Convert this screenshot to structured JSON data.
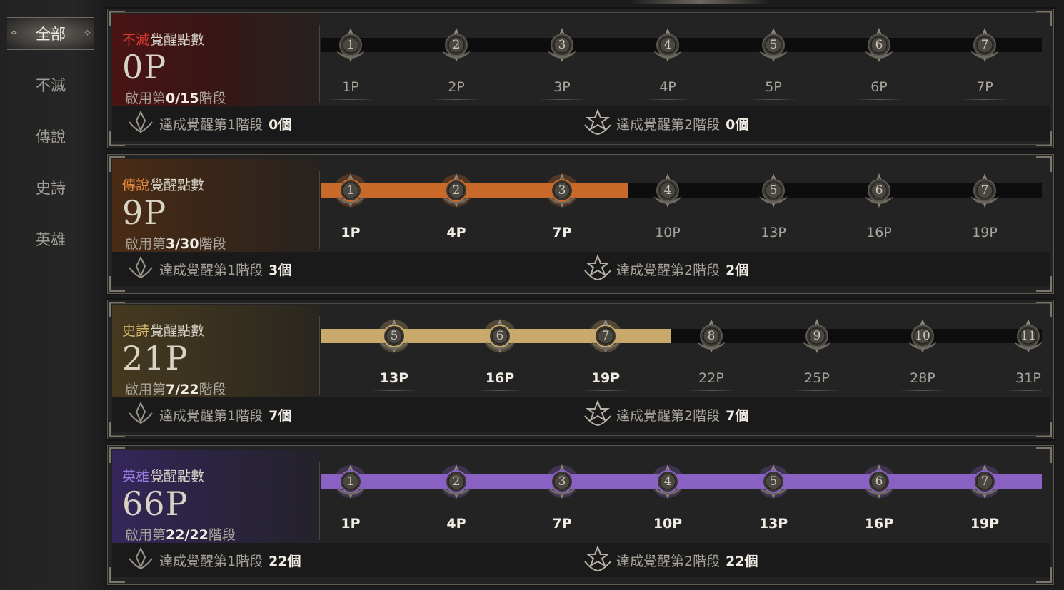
{
  "sidebar": {
    "items": [
      {
        "label": "全部",
        "active": true
      },
      {
        "label": "不滅",
        "active": false
      },
      {
        "label": "傳說",
        "active": false
      },
      {
        "label": "史詩",
        "active": false
      },
      {
        "label": "英雄",
        "active": false
      }
    ]
  },
  "colors": {
    "immortal": "#e0392f",
    "legendary": "#e58b3d",
    "epic": "#d7b56d",
    "hero": "#9b7be0",
    "fill_legendary": "#c96a2a",
    "fill_epic": "#c9aa6b",
    "fill_hero": "#8a62c4"
  },
  "panels": [
    {
      "grade": "不滅",
      "grade_color": "#e0392f",
      "title_suffix": "覺醒點數",
      "points": "0P",
      "stage_prefix": "啟用第",
      "stage_value": "0/15",
      "stage_suffix": "階段",
      "fill_color": "#c96a2a",
      "fill_fraction": 0.0,
      "nodes": [
        {
          "num": "1",
          "label": "1P",
          "on": false
        },
        {
          "num": "2",
          "label": "2P",
          "on": false
        },
        {
          "num": "3",
          "label": "3P",
          "on": false
        },
        {
          "num": "4",
          "label": "4P",
          "on": false
        },
        {
          "num": "5",
          "label": "5P",
          "on": false
        },
        {
          "num": "6",
          "label": "6P",
          "on": false
        },
        {
          "num": "7",
          "label": "7P",
          "on": false
        }
      ],
      "ach1": {
        "text": "達成覺醒第1階段",
        "count": "0個"
      },
      "ach2": {
        "text": "達成覺醒第2階段",
        "count": "0個"
      }
    },
    {
      "grade": "傳說",
      "grade_color": "#e58b3d",
      "title_suffix": "覺醒點數",
      "points": "9P",
      "stage_prefix": "啟用第",
      "stage_value": "3/30",
      "stage_suffix": "階段",
      "fill_color": "#c96a2a",
      "fill_fraction": 0.426,
      "nodes": [
        {
          "num": "1",
          "label": "1P",
          "on": true
        },
        {
          "num": "2",
          "label": "4P",
          "on": true
        },
        {
          "num": "3",
          "label": "7P",
          "on": true
        },
        {
          "num": "4",
          "label": "10P",
          "on": false
        },
        {
          "num": "5",
          "label": "13P",
          "on": false
        },
        {
          "num": "6",
          "label": "16P",
          "on": false
        },
        {
          "num": "7",
          "label": "19P",
          "on": false
        }
      ],
      "ach1": {
        "text": "達成覺醒第1階段",
        "count": "3個"
      },
      "ach2": {
        "text": "達成覺醒第2階段",
        "count": "2個"
      }
    },
    {
      "grade": "史詩",
      "grade_color": "#d7b56d",
      "title_suffix": "覺醒點數",
      "points": "21P",
      "stage_prefix": "啟用第",
      "stage_value": "7/22",
      "stage_suffix": "階段",
      "fill_color": "#c9aa6b",
      "fill_fraction": 0.485,
      "offset": true,
      "nodes": [
        {
          "num": "5",
          "label": "13P",
          "on": true
        },
        {
          "num": "6",
          "label": "16P",
          "on": true
        },
        {
          "num": "7",
          "label": "19P",
          "on": true
        },
        {
          "num": "8",
          "label": "22P",
          "on": false
        },
        {
          "num": "9",
          "label": "25P",
          "on": false
        },
        {
          "num": "10",
          "label": "28P",
          "on": false
        },
        {
          "num": "11",
          "label": "31P",
          "on": false
        }
      ],
      "ach1": {
        "text": "達成覺醒第1階段",
        "count": "7個"
      },
      "ach2": {
        "text": "達成覺醒第2階段",
        "count": "7個"
      }
    },
    {
      "grade": "英雄",
      "grade_color": "#9b7be0",
      "title_suffix": "覺醒點數",
      "points": "66P",
      "stage_prefix": "啟用第",
      "stage_value": "22/22",
      "stage_suffix": "階段",
      "fill_color": "#8a62c4",
      "fill_fraction": 1.0,
      "nodes": [
        {
          "num": "1",
          "label": "1P",
          "on": true
        },
        {
          "num": "2",
          "label": "4P",
          "on": true
        },
        {
          "num": "3",
          "label": "7P",
          "on": true
        },
        {
          "num": "4",
          "label": "10P",
          "on": true
        },
        {
          "num": "5",
          "label": "13P",
          "on": true
        },
        {
          "num": "6",
          "label": "16P",
          "on": true
        },
        {
          "num": "7",
          "label": "19P",
          "on": true
        }
      ],
      "ach1": {
        "text": "達成覺醒第1階段",
        "count": "22個"
      },
      "ach2": {
        "text": "達成覺醒第2階段",
        "count": "22個"
      }
    }
  ]
}
